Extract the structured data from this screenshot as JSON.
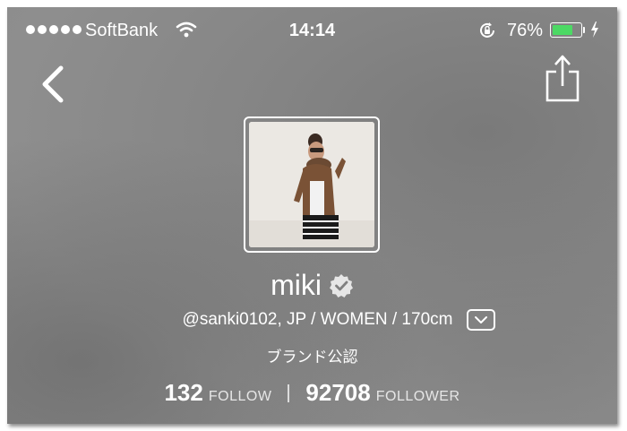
{
  "status_bar": {
    "carrier": "SoftBank",
    "time": "14:14",
    "battery_percent": "76%",
    "battery_level": 0.76,
    "battery_color": "#4cd964"
  },
  "nav": {
    "back_icon": "chevron-left-icon",
    "share_icon": "share-icon"
  },
  "profile": {
    "name": "miki",
    "verified_icon": "verified-badge-icon",
    "meta": "@sanki0102, JP / WOMEN / 170cm",
    "brand_label": "ブランド公認",
    "follow_count": "132",
    "follow_label": "FOLLOW",
    "follower_count": "92708",
    "follower_label": "FOLLOWER"
  }
}
